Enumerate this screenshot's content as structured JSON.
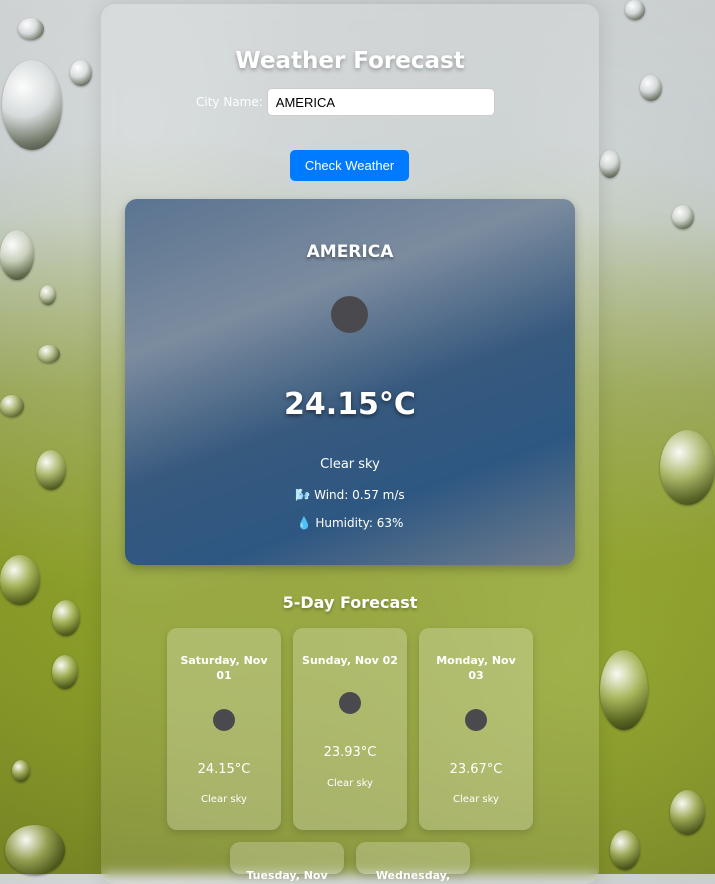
{
  "app": {
    "title": "Weather Forecast",
    "city_label": "City Name:",
    "city_value": "AMERICA",
    "button_label": "Check Weather"
  },
  "current": {
    "city": "AMERICA",
    "icon": "weather-icon",
    "temp": "24.15°C",
    "description": "Clear sky",
    "wind_icon": "🌬️",
    "wind": "Wind: 0.57 m/s",
    "humidity_icon": "💧",
    "humidity": "Humidity: 63%"
  },
  "forecast": {
    "title": "5-Day Forecast",
    "days": [
      {
        "date": "Saturday, Nov 01",
        "temp": "24.15°C",
        "desc": "Clear sky"
      },
      {
        "date": "Sunday, Nov 02",
        "temp": "23.93°C",
        "desc": "Clear sky"
      },
      {
        "date": "Monday, Nov 03",
        "temp": "23.67°C",
        "desc": "Clear sky"
      },
      {
        "date": "Tuesday, Nov",
        "temp": "",
        "desc": ""
      },
      {
        "date": "Wednesday,",
        "temp": "",
        "desc": ""
      }
    ]
  },
  "colors": {
    "button": "#007bff",
    "icon": "#4a4a4e"
  }
}
